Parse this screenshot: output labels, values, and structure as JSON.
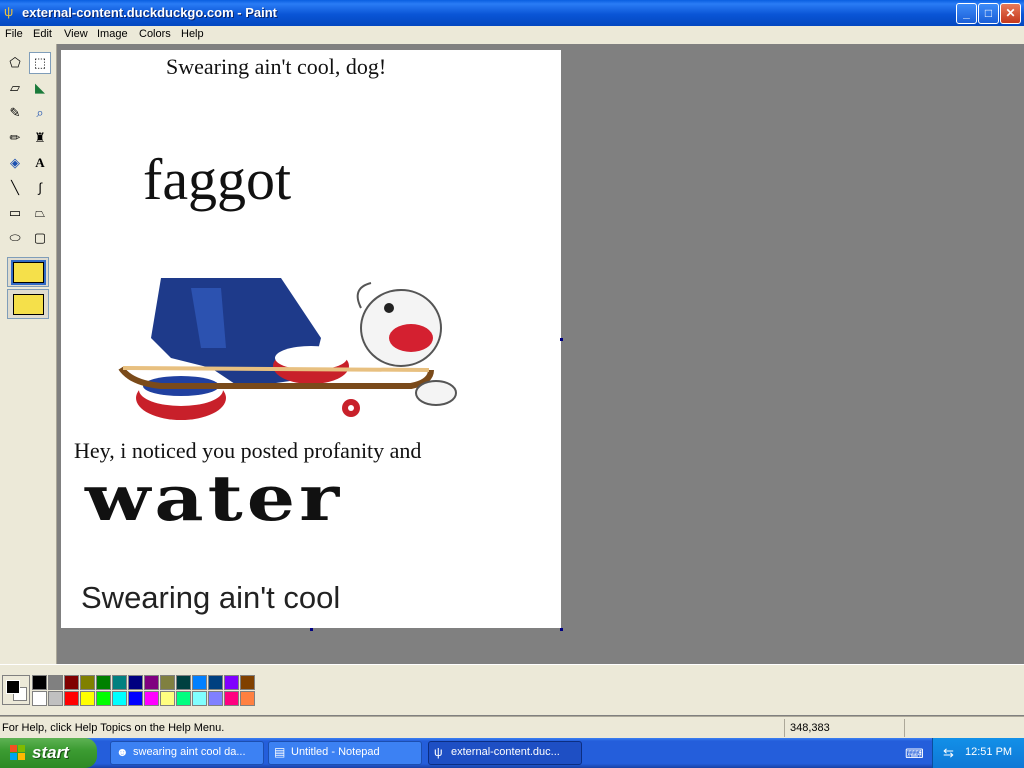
{
  "window": {
    "title": "external-content.duckduckgo.com - Paint",
    "buttons": {
      "minimize": "_",
      "maximize": "□",
      "close": "✕"
    }
  },
  "menu": [
    "File",
    "Edit",
    "View",
    "Image",
    "Colors",
    "Help"
  ],
  "tools": [
    {
      "name": "free-form-select-icon",
      "glyph": "⬠"
    },
    {
      "name": "select-icon",
      "glyph": "⬚"
    },
    {
      "name": "eraser-icon",
      "glyph": "▱"
    },
    {
      "name": "fill-icon",
      "glyph": "◣"
    },
    {
      "name": "pick-color-icon",
      "glyph": "✎"
    },
    {
      "name": "magnifier-icon",
      "glyph": "⌕"
    },
    {
      "name": "pencil-icon",
      "glyph": "✏"
    },
    {
      "name": "brush-icon",
      "glyph": "♜"
    },
    {
      "name": "airbrush-icon",
      "glyph": "◈"
    },
    {
      "name": "text-icon",
      "glyph": "A"
    },
    {
      "name": "line-icon",
      "glyph": "╲"
    },
    {
      "name": "curve-icon",
      "glyph": "∫"
    },
    {
      "name": "rectangle-icon",
      "glyph": "▭"
    },
    {
      "name": "polygon-icon",
      "glyph": "⏢"
    },
    {
      "name": "ellipse-icon",
      "glyph": "⬭"
    },
    {
      "name": "rounded-rectangle-icon",
      "glyph": "▢"
    }
  ],
  "canvas": {
    "caption_top": "Swearing ain't cool, dog!",
    "word_large": "faggot",
    "hey_line": "Hey, i noticed you posted profanity and",
    "word_water": "water",
    "caption_bottom": "Swearing ain't cool"
  },
  "palette": {
    "foreground": "#000000",
    "background": "#ffffff",
    "row1": [
      "#000000",
      "#808080",
      "#800000",
      "#808000",
      "#008000",
      "#008080",
      "#000080",
      "#800080",
      "#808040",
      "#004040",
      "#0080ff",
      "#004080",
      "#8000ff",
      "#804000"
    ],
    "row2": [
      "#ffffff",
      "#c0c0c0",
      "#ff0000",
      "#ffff00",
      "#00ff00",
      "#00ffff",
      "#0000ff",
      "#ff00ff",
      "#ffff80",
      "#00ff80",
      "#80ffff",
      "#8080ff",
      "#ff0080",
      "#ff8040"
    ]
  },
  "status": {
    "help_text": "For Help, click Help Topics on the Help Menu.",
    "coords": "348,383"
  },
  "taskbar": {
    "start_label": "start",
    "tasks": [
      {
        "label": "swearing aint cool da...",
        "icon": "☻"
      },
      {
        "label": "Untitled - Notepad",
        "icon": "▤"
      },
      {
        "label": "external-content.duc...",
        "icon": "ψ"
      }
    ],
    "clock": "12:51 PM"
  }
}
